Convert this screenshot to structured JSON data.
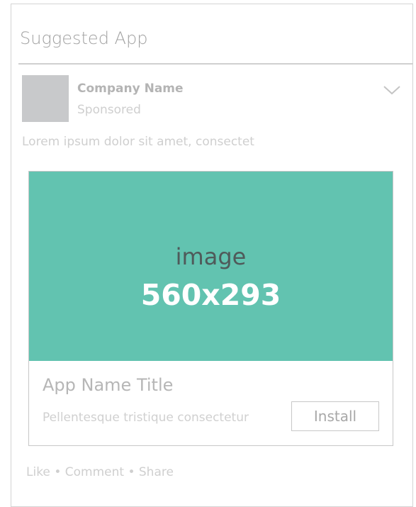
{
  "header": {
    "title": "Suggested App"
  },
  "post": {
    "company_name": "Company Name",
    "sponsored_label": "Sponsored",
    "body": "Lorem ipsum dolor sit amet, consectet",
    "menu_icon": "chevron-down-icon"
  },
  "ad": {
    "image_label": "image",
    "image_size": "560x293",
    "image_color": "#62c3b0",
    "app_title": "App Name Title",
    "app_description": "Pellentesque tristique consectetur",
    "install_label": "Install"
  },
  "actions": {
    "like": "Like",
    "comment": "Comment",
    "share": "Share",
    "separator": "•"
  }
}
